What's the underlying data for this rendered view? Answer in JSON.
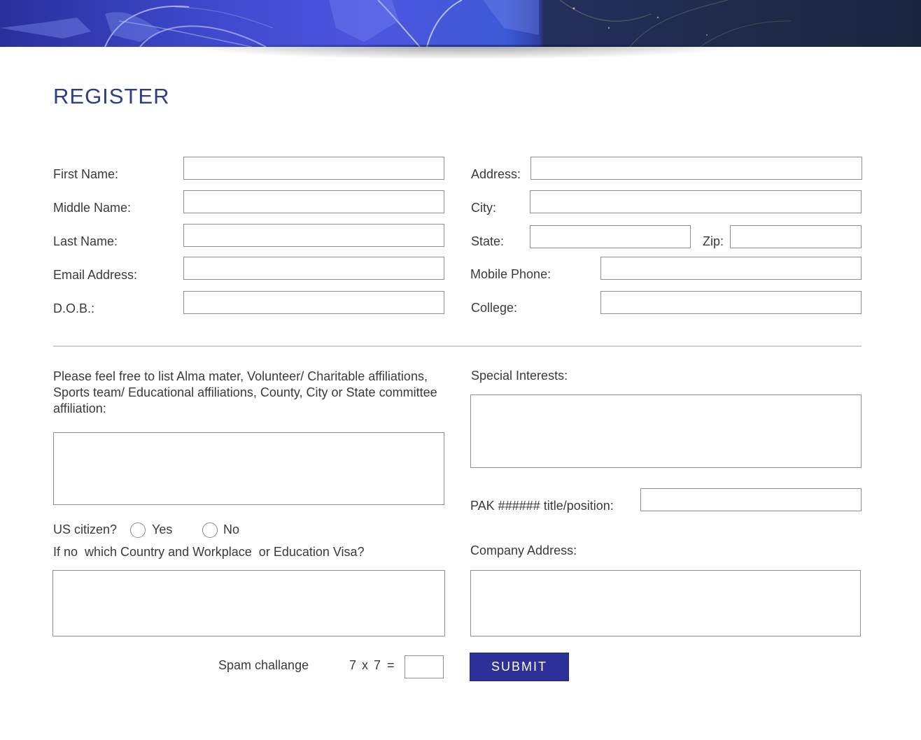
{
  "page": {
    "title": "REGISTER"
  },
  "left_fields": [
    {
      "label": "First Name:",
      "value": ""
    },
    {
      "label": "Middle Name:",
      "value": ""
    },
    {
      "label": "Last Name:",
      "value": ""
    },
    {
      "label": "Email Address:",
      "value": ""
    },
    {
      "label": "D.O.B.:",
      "value": ""
    }
  ],
  "right_fields": {
    "address": {
      "label": "Address:",
      "value": ""
    },
    "city": {
      "label": "City:",
      "value": ""
    },
    "state": {
      "label": "State:",
      "value": ""
    },
    "zip": {
      "label": "Zip:",
      "value": ""
    },
    "mobile": {
      "label": "Mobile Phone:",
      "value": ""
    },
    "college": {
      "label": "College:",
      "value": ""
    }
  },
  "affiliations": {
    "label": "Please feel free to list Alma mater, Volunteer/ Charitable affiliations, Sports team/ Educational affiliations, County, City or State committee affiliation:",
    "value": ""
  },
  "special_interests": {
    "label": "Special Interests:",
    "value": ""
  },
  "pak": {
    "label": "PAK ###### title/position:",
    "value": ""
  },
  "citizen": {
    "label": "US citizen?",
    "options": [
      "Yes",
      "No"
    ],
    "followup_label": "If no  which Country and Workplace  or Education Visa?",
    "followup_value": ""
  },
  "company_address": {
    "label": "Company Address:",
    "value": ""
  },
  "spam": {
    "label": "Spam challange",
    "a": "7",
    "op": "x",
    "b": "7",
    "eq": "=",
    "value": ""
  },
  "submit_label": "SUBMIT",
  "colors": {
    "title": "#2d3d8a",
    "submit_bg": "#2d3098",
    "banner_left": "#3b47c9",
    "banner_right": "#1f2a4a"
  }
}
